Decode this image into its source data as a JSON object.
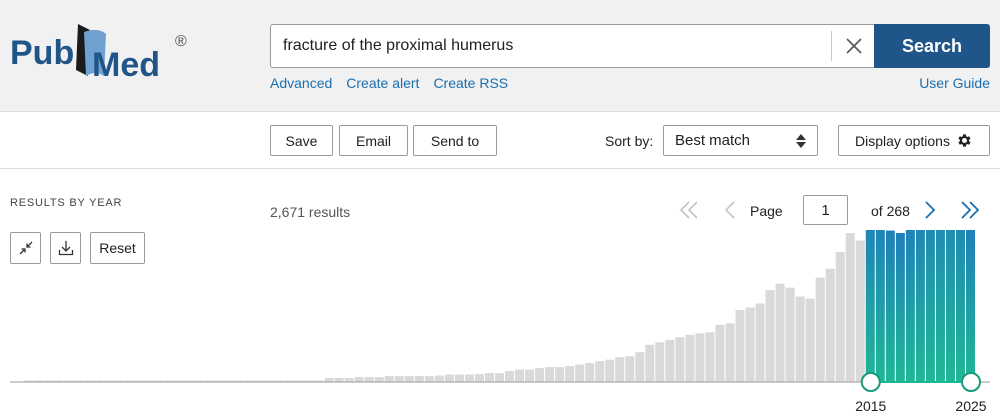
{
  "header": {
    "logo_pub": "Pub",
    "logo_med": "Med",
    "logo_reg": "®",
    "search_value": "fracture of the proximal humerus",
    "search_button": "Search",
    "links": [
      "Advanced",
      "Create alert",
      "Create RSS"
    ],
    "user_guide": "User Guide"
  },
  "toolbar": {
    "save": "Save",
    "email": "Email",
    "send_to": "Send to",
    "sort_label": "Sort by:",
    "sort_value": "Best match",
    "display_options": "Display options"
  },
  "results": {
    "section_title": "RESULTS BY YEAR",
    "reset": "Reset",
    "count": "2,671 results",
    "page_label": "Page",
    "page_value": "1",
    "page_of": "of 268"
  },
  "icons": {
    "clear": "close-icon",
    "sort": "sort-arrows-icon",
    "display": "gear-icon",
    "collapse": "collapse-icon",
    "download": "download-icon",
    "first": "double-chevron-left-icon",
    "prev": "chevron-left-icon",
    "next": "chevron-right-icon",
    "last": "double-chevron-right-icon"
  },
  "colors": {
    "brand_blue": "#20558a",
    "link_blue": "#1a6fb0",
    "bar_gray": "#d9d9d9",
    "bar_green": "#20b795",
    "bar_blue": "#1f7fba"
  },
  "chart_data": {
    "type": "bar",
    "title": "RESULTS BY YEAR",
    "selected_range": [
      2015,
      2025
    ],
    "range_labels": [
      "2015",
      "2025"
    ],
    "ylim": [
      0,
      290
    ],
    "bars": [
      3,
      3,
      3,
      3,
      3,
      3,
      3,
      3,
      3,
      3,
      3,
      3,
      3,
      3,
      3,
      3,
      3,
      3,
      3,
      3,
      3,
      3,
      3,
      3,
      3,
      3,
      3,
      3,
      3,
      3,
      8,
      8,
      8,
      10,
      10,
      10,
      12,
      12,
      12,
      12,
      12,
      13,
      15,
      15,
      15,
      16,
      18,
      18,
      22,
      25,
      25,
      28,
      30,
      30,
      32,
      35,
      38,
      42,
      45,
      50,
      52,
      60,
      75,
      80,
      85,
      90,
      95,
      98,
      100,
      115,
      118,
      145,
      150,
      158,
      185,
      198,
      190,
      172,
      168,
      210,
      228,
      262,
      300,
      285,
      340,
      335,
      305,
      300,
      322,
      360,
      395,
      410,
      415,
      400,
      310
    ]
  }
}
